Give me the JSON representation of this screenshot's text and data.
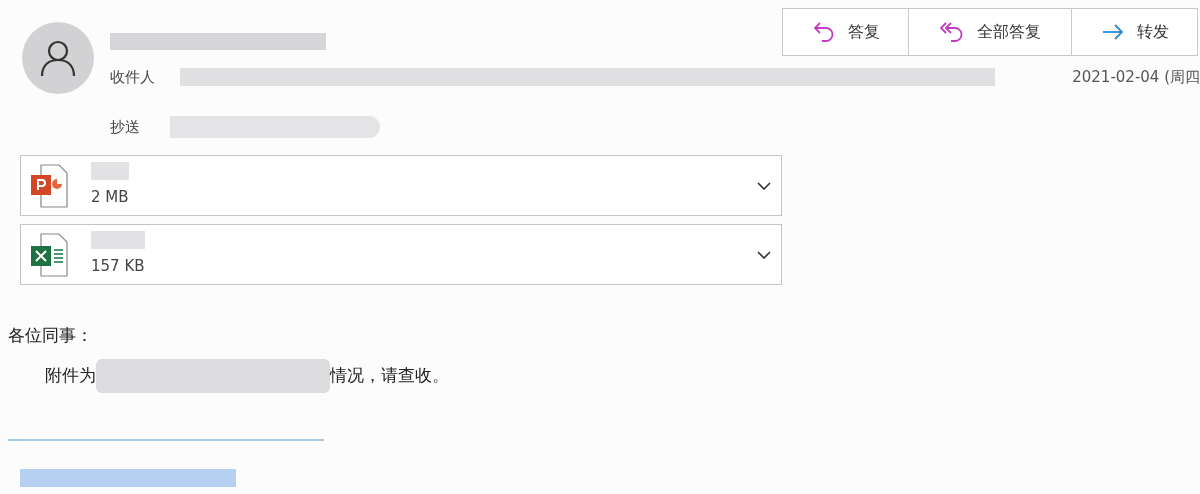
{
  "header": {
    "recipients_label": "收件人",
    "cc_label": "抄送",
    "date": "2021-02-04 (周四"
  },
  "actions": [
    {
      "kind": "reply",
      "label": "答复"
    },
    {
      "kind": "reply_all",
      "label": "全部答复"
    },
    {
      "kind": "forward",
      "label": "转发"
    }
  ],
  "attachments": [
    {
      "kind": "powerpoint",
      "size": "2 MB"
    },
    {
      "kind": "excel",
      "size": "157 KB"
    }
  ],
  "body": {
    "greeting": "各位同事：",
    "line_start": "附件为",
    "line_end": "情况，请查收。"
  }
}
